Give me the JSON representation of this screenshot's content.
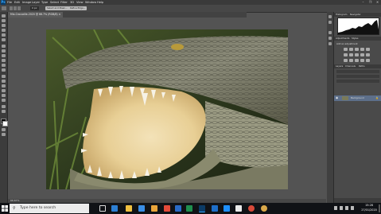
{
  "app": {
    "logo_text": "Ps"
  },
  "menubar": {
    "items": [
      "File",
      "Edit",
      "Image",
      "Layer",
      "Type",
      "Select",
      "Filter",
      "3D",
      "View",
      "Window",
      "Help"
    ]
  },
  "optionsbar": {
    "anti_alias_value": "0 px",
    "select_mask_label": "Select and Mask...",
    "refine_label": "Refine Edge..."
  },
  "document": {
    "tab_title": "Mix-Crocodile-2020 @ 66.7% (RGB/8) ×",
    "zoom": "66.67%",
    "photo_subject": "crocodile open jaws"
  },
  "panels": {
    "histogram_tabs": [
      "Histogram",
      "Navigator"
    ],
    "adjustments_tabs": [
      "Adjustments",
      "Styles"
    ],
    "adjustments_hint": "Add an adjustment",
    "layers_tabs": [
      "Layers",
      "Channels",
      "Paths"
    ],
    "layer_name": "Background"
  },
  "taskbar": {
    "search_placeholder": "Type here to search",
    "time": "15:28",
    "date": "27/01/2020",
    "accent": "#1e90ff"
  }
}
